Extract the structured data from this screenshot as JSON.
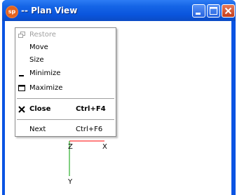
{
  "window": {
    "title": "-- Plan View",
    "app_icon_text": "sp",
    "app_icon": "app-logo-icon"
  },
  "caption_buttons": {
    "minimize_icon": "minimize-icon",
    "maximize_icon": "maximize-icon",
    "close_icon": "close-icon"
  },
  "system_menu": {
    "items": [
      {
        "label": "Restore",
        "icon": "restore-icon",
        "enabled": false,
        "shortcut": ""
      },
      {
        "label": "Move",
        "icon": "",
        "enabled": true,
        "shortcut": ""
      },
      {
        "label": "Size",
        "icon": "",
        "enabled": true,
        "shortcut": ""
      },
      {
        "label": "Minimize",
        "icon": "minimize-icon",
        "enabled": true,
        "shortcut": ""
      },
      {
        "label": "Maximize",
        "icon": "maximize-icon",
        "enabled": true,
        "shortcut": ""
      },
      {
        "label": "Close",
        "icon": "close-icon",
        "enabled": true,
        "bold": true,
        "shortcut": "Ctrl+F4"
      },
      {
        "label": "Next",
        "icon": "",
        "enabled": true,
        "shortcut": "Ctrl+F6"
      }
    ]
  },
  "axes": {
    "x_label": "X",
    "y_label": "Y",
    "z_label": "Z",
    "x_color": "#ff0000",
    "y_color": "#00a000"
  },
  "colors": {
    "titlebar": "#0a55dd",
    "close_button": "#c53d1a"
  }
}
